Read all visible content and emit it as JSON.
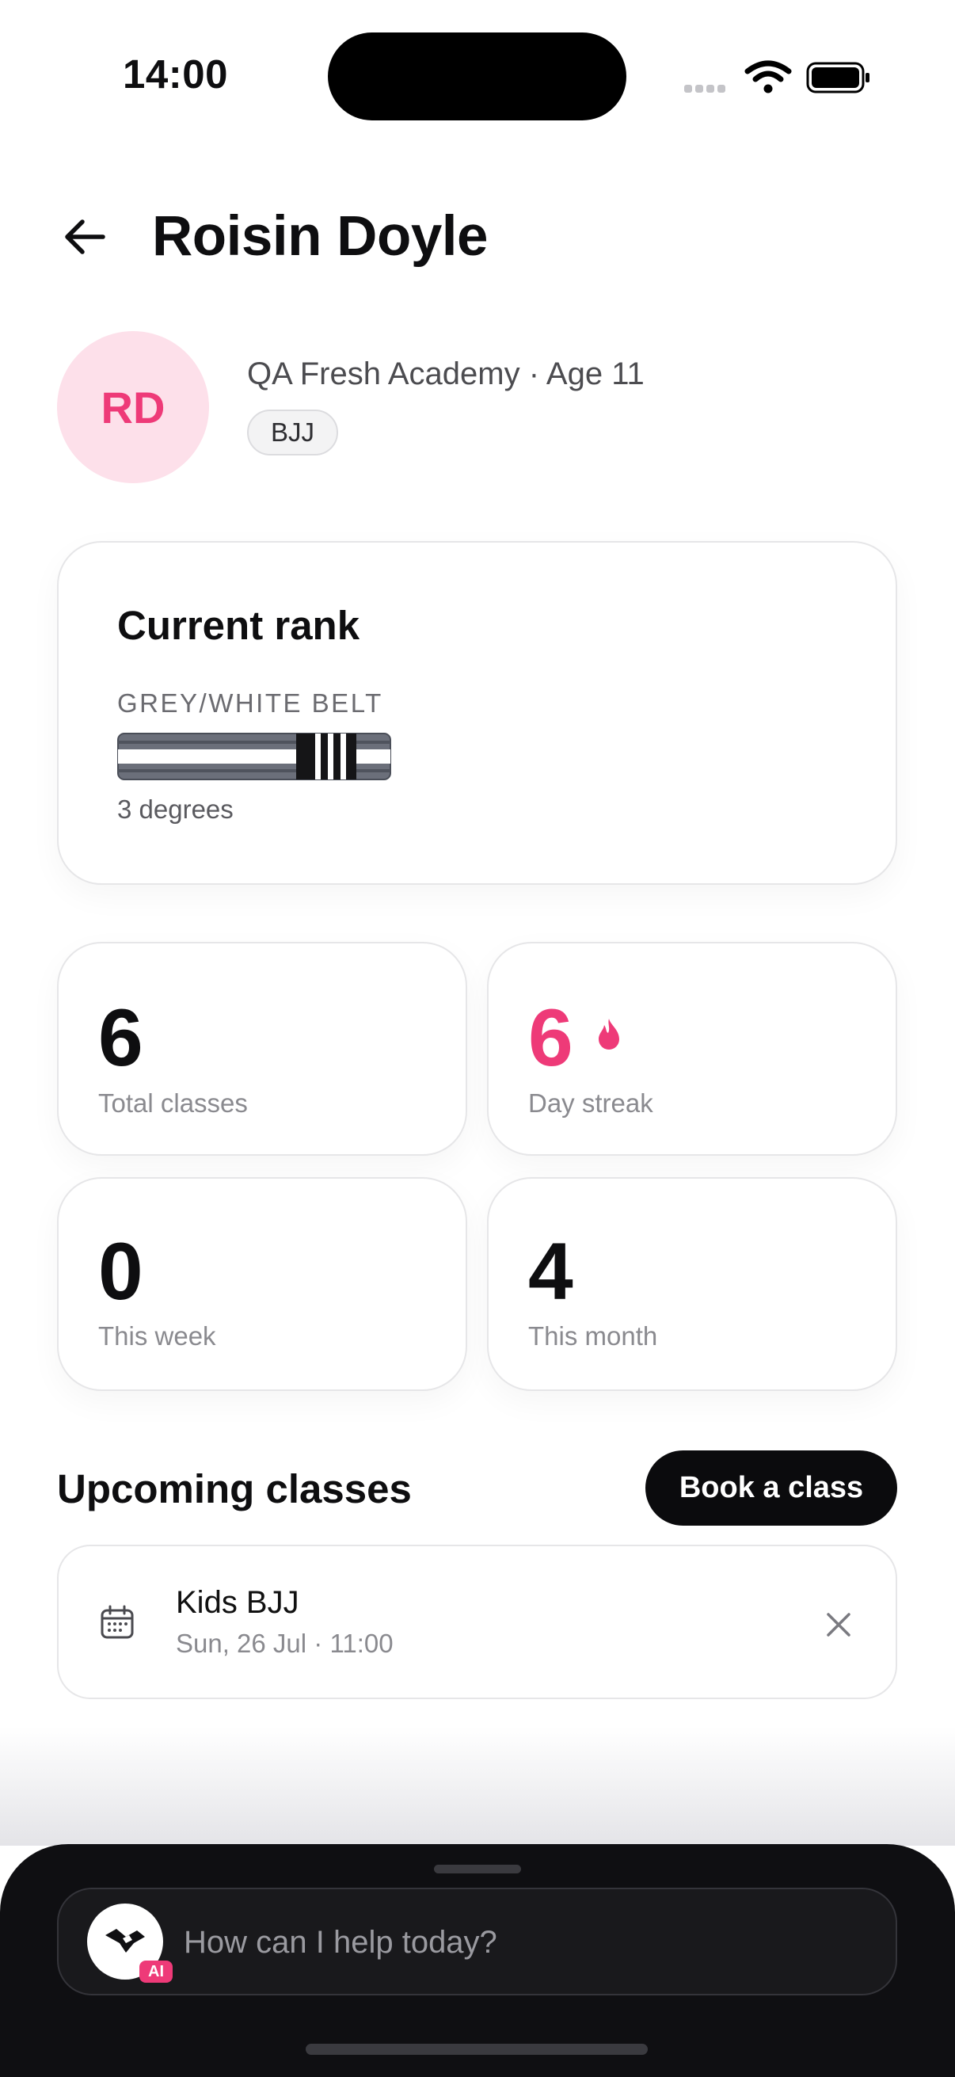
{
  "status_bar": {
    "time": "14:00"
  },
  "header": {
    "title": "Roisin Doyle"
  },
  "profile": {
    "initials": "RD",
    "meta": "QA Fresh Academy · Age 11",
    "discipline": "BJJ"
  },
  "rank": {
    "heading": "Current rank",
    "belt": "GREY/WHITE BELT",
    "degrees": "3 degrees",
    "degree_count": 3
  },
  "stats": [
    {
      "value": "6",
      "label": "Total classes"
    },
    {
      "value": "6",
      "label": "Day streak"
    },
    {
      "value": "0",
      "label": "This week"
    },
    {
      "value": "4",
      "label": "This month"
    }
  ],
  "upcoming": {
    "title": "Upcoming classes",
    "book_label": "Book a class",
    "items": [
      {
        "name": "Kids BJJ",
        "when": "Sun, 26 Jul · 11:00"
      }
    ]
  },
  "assistant": {
    "placeholder": "How can I help today?",
    "badge": "AI"
  },
  "colors": {
    "accent": "#ee3a78",
    "avatar_bg": "#fde0ea",
    "primary_button": "#0b0b0d",
    "sheet_bg": "#0f0f12"
  }
}
